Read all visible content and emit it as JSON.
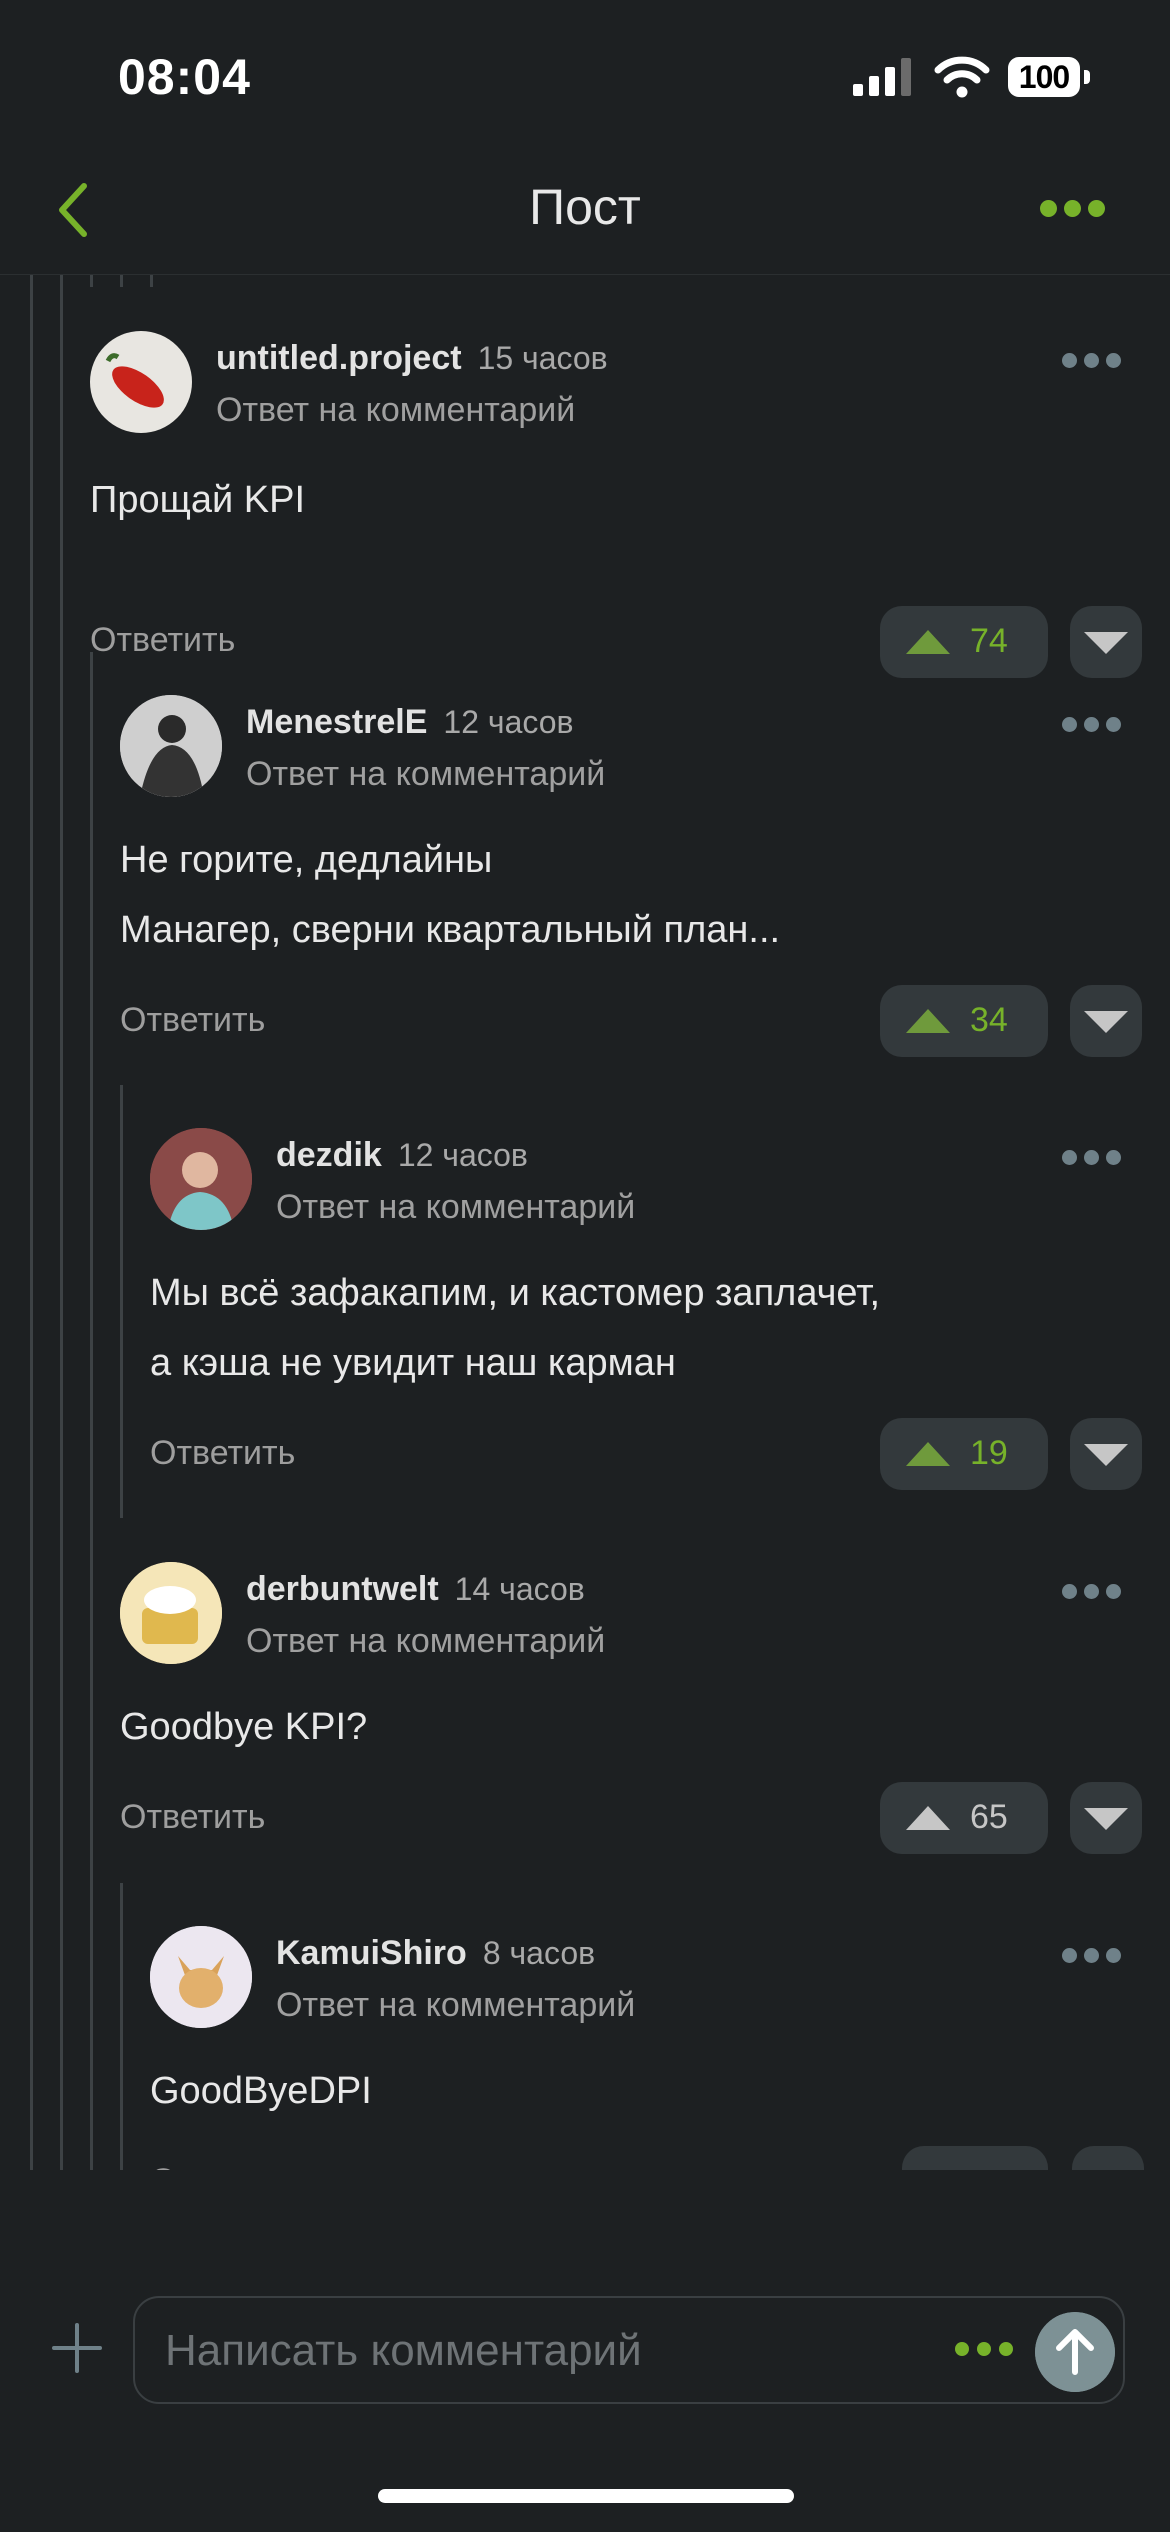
{
  "status": {
    "time": "08:04",
    "battery": "100"
  },
  "nav": {
    "title": "Пост"
  },
  "comments": [
    {
      "author": "untitled.project",
      "time": "15 часов",
      "reply_to": "Ответ на комментарий",
      "lines": [
        "Прощай KPI"
      ],
      "reply": "Ответить",
      "votes": "74"
    },
    {
      "author": "MenestrelE",
      "time": "12 часов",
      "reply_to": "Ответ на комментарий",
      "lines": [
        "Не горите, дедлайны",
        "Манагер, сверни квартальный план..."
      ],
      "reply": "Ответить",
      "votes": "34"
    },
    {
      "author": "dezdik",
      "time": "12 часов",
      "reply_to": "Ответ на комментарий",
      "lines": [
        "Мы всё зафакапим, и кастомер заплачет,",
        "а кэша не увидит наш карман"
      ],
      "reply": "Ответить",
      "votes": "19"
    },
    {
      "author": "derbuntwelt",
      "time": "14 часов",
      "reply_to": "Ответ на комментарий",
      "lines": [
        "Goodbye KPI?"
      ],
      "reply": "Ответить",
      "votes": "65"
    },
    {
      "author": "KamuiShiro",
      "time": "8 часов",
      "reply_to": "Ответ на комментарий",
      "lines": [
        "GoodByeDPI"
      ],
      "reply": "Ответить",
      "votes": ""
    }
  ],
  "composer": {
    "placeholder": "Написать комментарий"
  },
  "colors": {
    "background": "#1d2022",
    "accent": "#77b22a",
    "vote_bg": "#33393c"
  }
}
